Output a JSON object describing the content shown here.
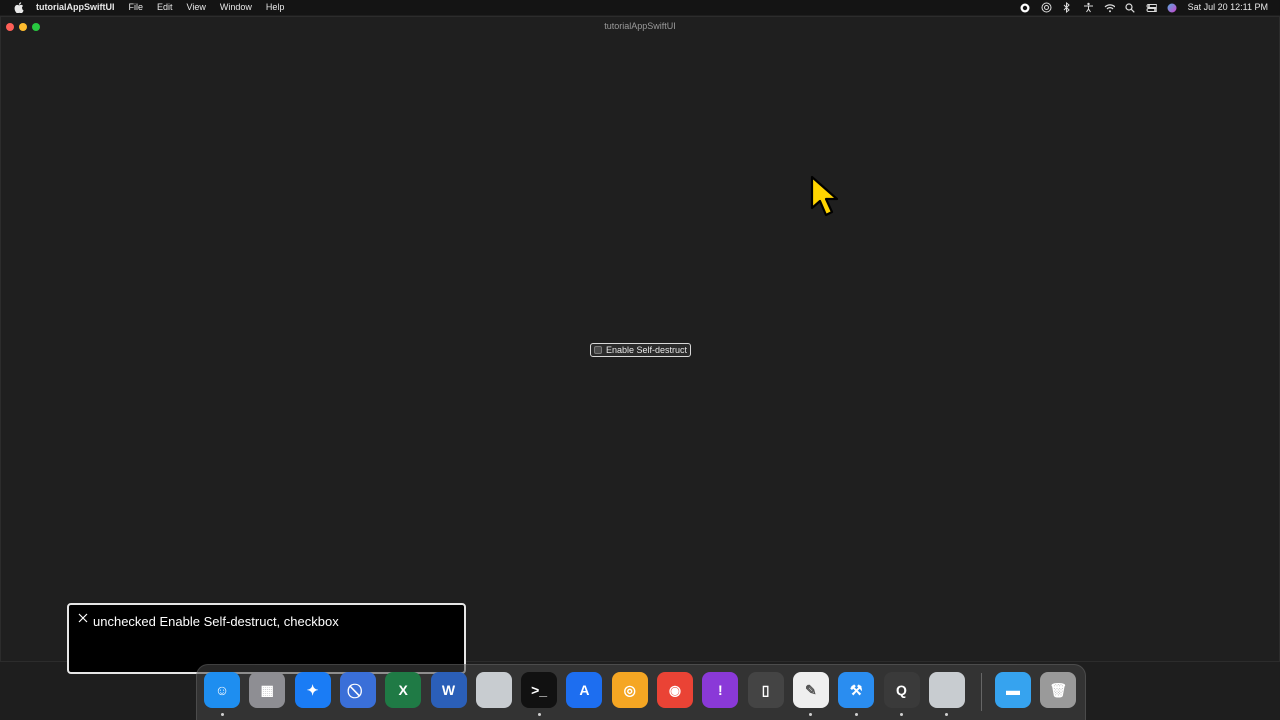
{
  "menubar": {
    "app_name": "tutorialAppSwiftUI",
    "items": [
      "File",
      "Edit",
      "View",
      "Window",
      "Help"
    ],
    "clock": "Sat Jul 20  12:11 PM",
    "status_icons": [
      "screen-record-icon",
      "airdrop-icon",
      "bluetooth-icon",
      "accessibility-icon",
      "wifi-icon",
      "search-icon",
      "control-center-icon",
      "siri-icon"
    ]
  },
  "window": {
    "title": "tutorialAppSwiftUI",
    "checkbox": {
      "label": "Enable Self-destruct",
      "checked": false
    }
  },
  "voiceover": {
    "caption": "unchecked Enable Self-destruct, checkbox"
  },
  "dock": {
    "items": [
      {
        "name": "finder",
        "color": "#1e8ef0",
        "glyph": "☺"
      },
      {
        "name": "launchpad",
        "color": "#8e8e93",
        "glyph": "▦"
      },
      {
        "name": "safari",
        "color": "#1a7cf5",
        "glyph": "✦"
      },
      {
        "name": "blocked-app",
        "color": "#3a6fd8",
        "glyph": "⃠"
      },
      {
        "name": "excel",
        "color": "#1f7a45",
        "glyph": "X"
      },
      {
        "name": "word",
        "color": "#2b5fb8",
        "glyph": "W"
      },
      {
        "name": "blank-app",
        "color": "#c8ccd0",
        "glyph": ""
      },
      {
        "name": "terminal",
        "color": "#111111",
        "glyph": ">_"
      },
      {
        "name": "xcode-instruments",
        "color": "#1d6ef0",
        "glyph": "A"
      },
      {
        "name": "chrome-canary",
        "color": "#f5a623",
        "glyph": "◎"
      },
      {
        "name": "chrome",
        "color": "#ea4335",
        "glyph": "◉"
      },
      {
        "name": "feedback-assistant",
        "color": "#8a39d8",
        "glyph": "!"
      },
      {
        "name": "simulator",
        "color": "#444444",
        "glyph": "▯"
      },
      {
        "name": "textedit",
        "color": "#efefef",
        "glyph": "✎"
      },
      {
        "name": "xcode-beta",
        "color": "#2a8df0",
        "glyph": "⚒"
      },
      {
        "name": "quicktime",
        "color": "#3a3a3a",
        "glyph": "Q"
      },
      {
        "name": "blank-app-2",
        "color": "#c8ccd0",
        "glyph": ""
      },
      {
        "name": "downloads-folder",
        "color": "#36a3ef",
        "glyph": "▬"
      },
      {
        "name": "trash",
        "color": "#9a9a9a",
        "glyph": "🗑"
      }
    ]
  }
}
